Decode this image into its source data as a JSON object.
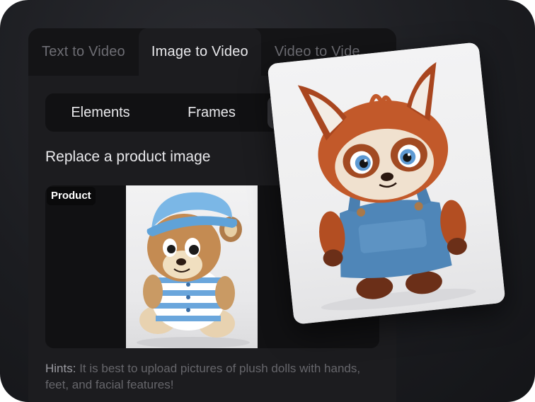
{
  "tabs": [
    {
      "label": "Text to Video",
      "active": false
    },
    {
      "label": "Image to Video",
      "active": true
    },
    {
      "label": "Video to Vide",
      "active": false
    }
  ],
  "segments": [
    {
      "label": "Elements"
    },
    {
      "label": "Frames"
    },
    {
      "label": ""
    }
  ],
  "section_heading": "Replace a product image",
  "upload": {
    "badge": "Product",
    "image_icon": "plush-bear-image"
  },
  "hint": {
    "label": "Hints:",
    "text": " It is best to upload pictures of plush dolls with hands, feet, and facial features!"
  },
  "result_card": {
    "image_icon": "plush-fox-image"
  },
  "colors": {
    "background": "#1b1c20",
    "panel": "#1c1c1f",
    "text": "#e9e9ec",
    "muted": "#66666b"
  }
}
